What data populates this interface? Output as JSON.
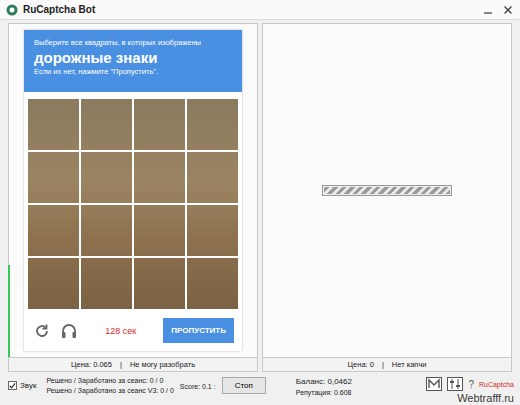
{
  "window": {
    "title": "RuCaptcha Bot"
  },
  "captcha": {
    "instruction": "Выберите все квадраты, в которых изображены",
    "target": "дорожные знаки",
    "hint": "Если их нет, нажмите \"Пропустить\".",
    "tiles": [
      {
        "selected": false
      },
      {
        "selected": false
      },
      {
        "selected": false
      },
      {
        "selected": false
      },
      {
        "selected": false
      },
      {
        "selected": false
      },
      {
        "selected": false
      },
      {
        "selected": false
      },
      {
        "selected": false
      },
      {
        "selected": false
      },
      {
        "selected": false
      },
      {
        "selected": false
      },
      {
        "selected": false
      },
      {
        "selected": false
      },
      {
        "selected": false
      },
      {
        "selected": false
      }
    ],
    "timer": "128 сек",
    "skip_button": "ПРОПУСТИТЬ"
  },
  "left_status": {
    "price": "Цена: 0.065",
    "separator": "|",
    "message": "Не могу разобрать"
  },
  "right_panel": {
    "progress": {
      "level": 1
    }
  },
  "right_status": {
    "price": "Цена: 0",
    "separator": "|",
    "message": "Нет капчи"
  },
  "bottom_bar": {
    "sound": {
      "label": "Звук",
      "checked": true
    },
    "stats": [
      "Решено / Заработано за сеанс: 0 / 0",
      "Решено / Заработано за сеанс V3: 0 / 0"
    ],
    "score": "Score: 0.1 :",
    "stop_button": "Стоп",
    "balance": "Баланс: 0,0462",
    "reputation": "Репутация: 0.608",
    "help": "?",
    "brand": "RuCaptcha"
  },
  "watermark": "Webtrafff.ru"
}
